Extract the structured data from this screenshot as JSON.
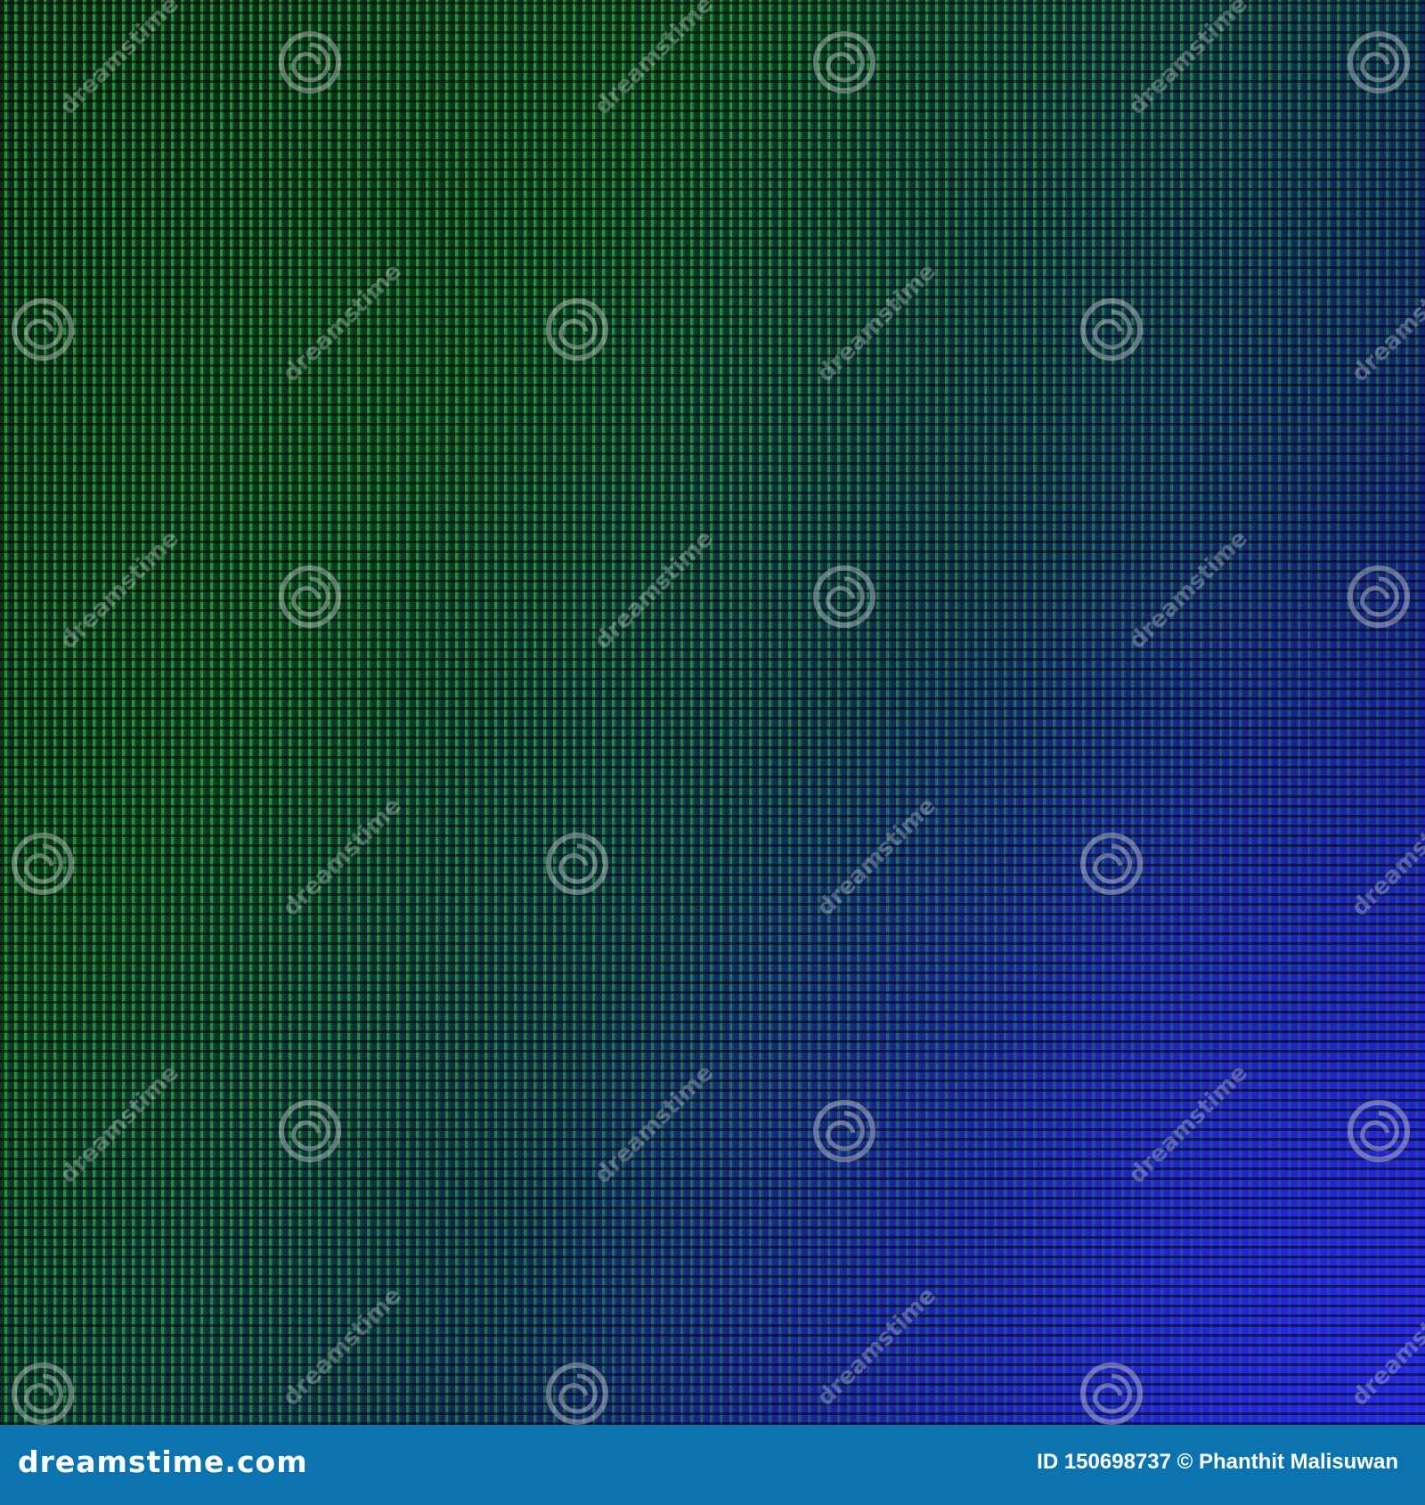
{
  "photo": {
    "subject": "led-pixel-macro",
    "colors": {
      "led_green": "#3ce650",
      "led_blue": "#2828e6",
      "gap_dark": "#050a08"
    }
  },
  "watermark": {
    "icon": "dreamstime-spiral-icon",
    "text": "dreamstime"
  },
  "footer": {
    "logo_text": "dreamstime.com",
    "id_label": "ID 150698737",
    "copyright_symbol": "©",
    "author": "Phanthit Malisuwan",
    "background_color": "#0a73b0"
  }
}
